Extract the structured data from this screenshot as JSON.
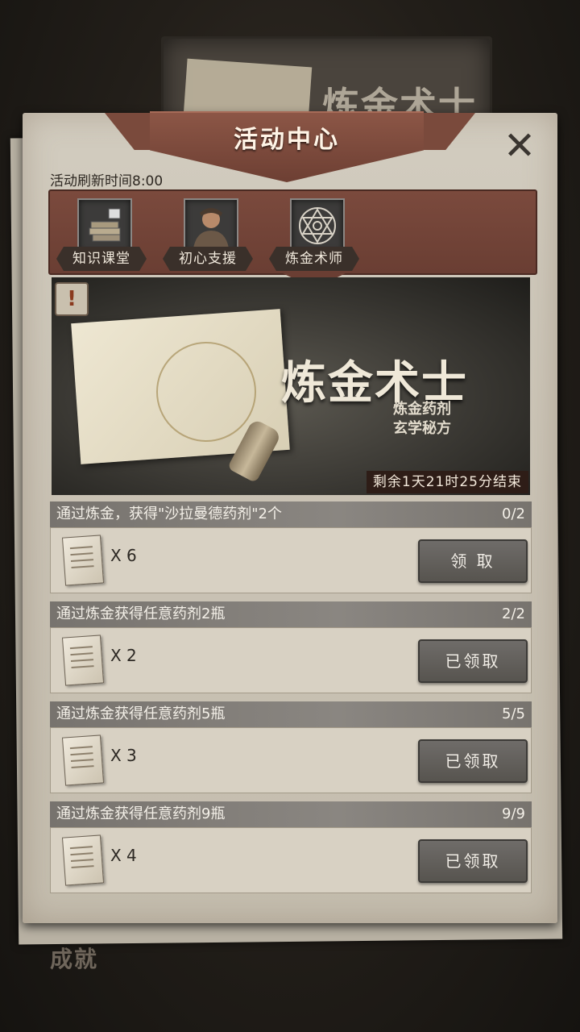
{
  "background": {
    "board_title": "炼金术士",
    "achievement_label": "成就"
  },
  "header": {
    "title": "活动中心",
    "refresh_time": "活动刷新时间8:00"
  },
  "tabs": [
    {
      "label": "知识课堂",
      "icon": "books-icon"
    },
    {
      "label": "初心支援",
      "icon": "character-portrait-icon"
    },
    {
      "label": "炼金术师",
      "icon": "hexagram-icon",
      "selected": true
    }
  ],
  "banner": {
    "title": "炼金术士",
    "subtitle_line1": "炼金药剂",
    "subtitle_line2": "玄学秘方",
    "warning": "!",
    "timer": "剩余1天21时25分结束"
  },
  "tasks": [
    {
      "name": "通过炼金，获得\"沙拉曼德药剂\"2个",
      "progress": "0/2",
      "reward_icon": "scroll-paper-icon",
      "reward_count": "X 6",
      "button": "领 取"
    },
    {
      "name": "通过炼金获得任意药剂2瓶",
      "progress": "2/2",
      "reward_icon": "scroll-paper-icon",
      "reward_count": "X 2",
      "button": "已领取"
    },
    {
      "name": "通过炼金获得任意药剂5瓶",
      "progress": "5/5",
      "reward_icon": "scroll-paper-icon",
      "reward_count": "X 3",
      "button": "已领取"
    },
    {
      "name": "通过炼金获得任意药剂9瓶",
      "progress": "9/9",
      "reward_icon": "scroll-paper-icon",
      "reward_count": "X 4",
      "button": "已领取"
    }
  ],
  "colors": {
    "accent_brown": "#7a4a3c",
    "panel_paper": "#cdc6b8",
    "button_gray": "#5f5c58"
  }
}
